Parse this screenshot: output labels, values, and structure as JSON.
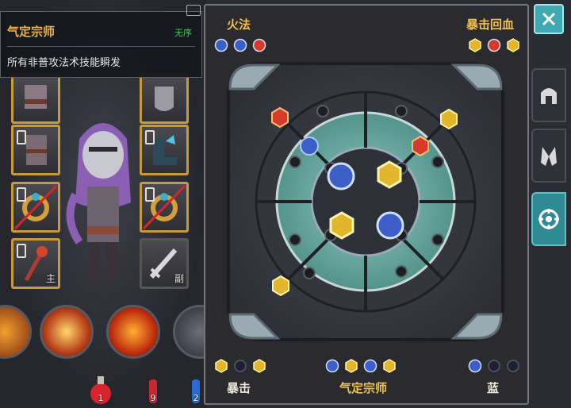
{
  "tooltip": {
    "title": "气定宗师",
    "badge": "无序",
    "description": "所有非普攻法术技能瞬发"
  },
  "equipment": {
    "slots": [
      {
        "icon": "shoulder-armor-icon",
        "locked": false,
        "disabled": false,
        "tag": ""
      },
      {
        "icon": "gauntlet-icon",
        "locked": false,
        "disabled": false,
        "tag": ""
      },
      {
        "icon": "body-armor-icon",
        "locked": true,
        "disabled": false,
        "tag": ""
      },
      {
        "icon": "boots-icon",
        "locked": true,
        "disabled": false,
        "tag": ""
      },
      {
        "icon": "ring-icon",
        "locked": true,
        "disabled": true,
        "tag": ""
      },
      {
        "icon": "ring-icon",
        "locked": true,
        "disabled": true,
        "tag": ""
      },
      {
        "icon": "staff-icon",
        "locked": true,
        "disabled": false,
        "tag": "主"
      },
      {
        "icon": "sword-icon",
        "locked": false,
        "disabled": false,
        "tag": "副"
      }
    ]
  },
  "potions": [
    {
      "count": "1",
      "color": "#d8242c"
    },
    {
      "count": "9",
      "color": "#c8282e"
    },
    {
      "count": "2",
      "color": "#2a6ad8"
    }
  ],
  "panel": {
    "top_left_label": "火法",
    "top_right_label": "暴击回血",
    "top_left_gems": [
      "blue",
      "blue",
      "red"
    ],
    "top_right_gems": [
      "gold",
      "red",
      "gold"
    ],
    "bottom_left_label": "暴击",
    "bottom_center_label": "气定宗师",
    "bottom_right_label": "蓝",
    "bottom_left_gems": [
      "gold",
      "empty",
      "gold"
    ],
    "bottom_center_gems": [
      "blue",
      "gold",
      "blue",
      "gold"
    ],
    "bottom_right_gems": [
      "blue",
      "empty",
      "empty"
    ]
  },
  "colors": {
    "gold": "#f0c050",
    "label_white": "#ece8dc",
    "teal": "#3fa8b2",
    "gem_red": "#d83a2a",
    "gem_blue": "#3b5ec8",
    "gem_gold": "#e3b52a"
  },
  "side_tabs": [
    {
      "icon": "helmet-icon",
      "active": false
    },
    {
      "icon": "gloves-icon",
      "active": false
    },
    {
      "icon": "crosshair-icon",
      "active": true
    }
  ],
  "close_icon": "close-icon"
}
